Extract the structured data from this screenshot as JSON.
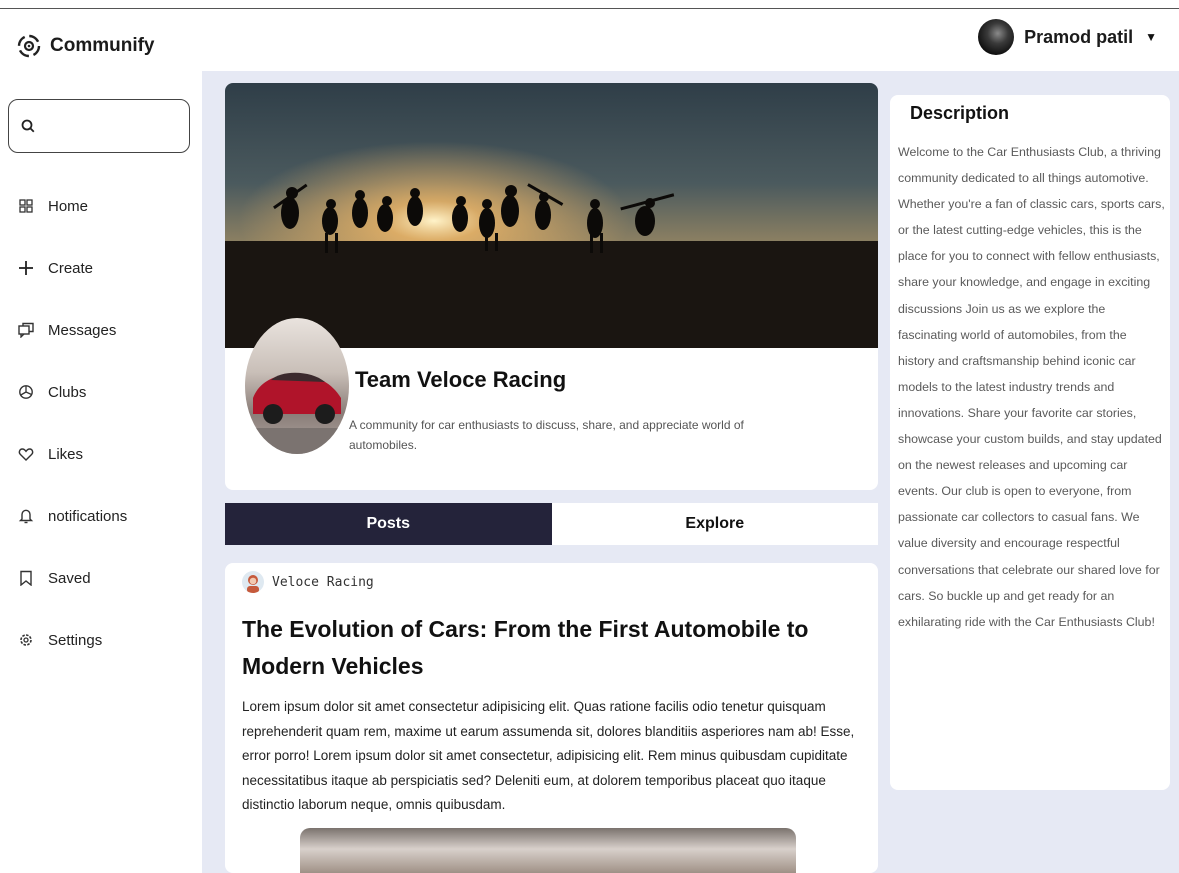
{
  "header": {
    "app_name": "Communify",
    "user": {
      "name": "Pramod patil"
    }
  },
  "sidebar": {
    "search": {
      "placeholder": ""
    },
    "items": [
      {
        "label": "Home",
        "icon": "grid-icon"
      },
      {
        "label": "Create",
        "icon": "plus-icon"
      },
      {
        "label": "Messages",
        "icon": "chat-icon"
      },
      {
        "label": "Clubs",
        "icon": "clubs-icon"
      },
      {
        "label": "Likes",
        "icon": "heart-icon"
      },
      {
        "label": "notifications",
        "icon": "bell-icon"
      },
      {
        "label": "Saved",
        "icon": "bookmark-icon"
      },
      {
        "label": "Settings",
        "icon": "gear-icon"
      }
    ]
  },
  "club": {
    "name": "Team Veloce Racing",
    "tagline": "A community for car enthusiasts to discuss, share, and appreciate world of automobiles."
  },
  "tabs": [
    {
      "label": "Posts",
      "active": true
    },
    {
      "label": "Explore",
      "active": false
    }
  ],
  "post": {
    "author": "Veloce Racing",
    "title": "The Evolution of Cars: From the First Automobile to Modern Vehicles",
    "body": "Lorem ipsum dolor sit amet consectetur adipisicing elit. Quas ratione facilis odio tenetur quisquam reprehenderit quam rem, maxime ut earum assumenda sit, dolores blanditiis asperiores nam ab! Esse, error porro! Lorem ipsum dolor sit amet consectetur, adipisicing elit. Rem minus quibusdam cupiditate necessitatibus itaque ab perspiciatis sed? Deleniti eum, at dolorem temporibus placeat quo itaque distinctio laborum neque, omnis quibusdam."
  },
  "description": {
    "title": "Description",
    "text": "Welcome to the Car Enthusiasts Club, a thriving community dedicated to all things automotive. Whether you're a fan of classic cars, sports cars, or the latest cutting-edge vehicles, this is the place for you to connect with fellow enthusiasts, share your knowledge, and engage in exciting discussions Join us as we explore the fascinating world of automobiles, from the history and craftsmanship behind iconic car models to the latest industry trends and innovations. Share your favorite car stories, showcase your custom builds, and stay updated on the newest releases and upcoming car events. Our club is open to everyone, from passionate car collectors to casual fans. We value diversity and encourage respectful conversations that celebrate our shared love for cars. So buckle up and get ready for an exhilarating ride with the Car Enthusiasts Club!"
  },
  "colors": {
    "accent": "#24233a",
    "main_bg": "#e6e9f4",
    "car_red": "#b0142a"
  }
}
